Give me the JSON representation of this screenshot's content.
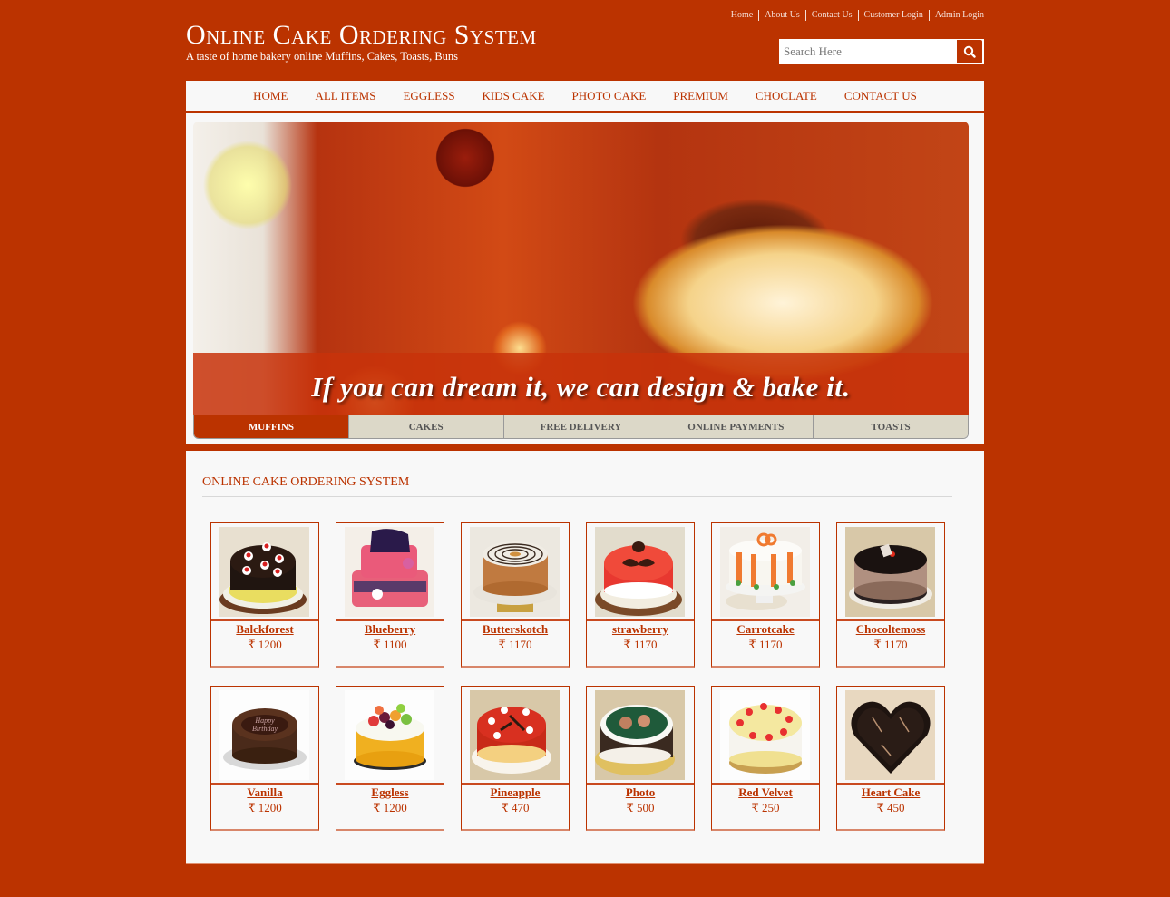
{
  "top_links": [
    "Home",
    "About Us",
    "Contact Us",
    "Customer Login",
    "Admin Login"
  ],
  "logo": {
    "title": "Online Cake Ordering System",
    "tagline": "A taste of home bakery online Muffins, Cakes, Toasts, Buns"
  },
  "search": {
    "placeholder": "Search Here",
    "value": "",
    "icon": "search-icon"
  },
  "nav": [
    "HOME",
    "ALL ITEMS",
    "EGGLESS",
    "KIDS CAKE",
    "PHOTO CAKE",
    "PREMIUM",
    "CHOCLATE",
    "CONTACT US"
  ],
  "banner": {
    "caption": "If you can dream it, we can design & bake it."
  },
  "tabs": [
    {
      "label": "MUFFINS",
      "active": true
    },
    {
      "label": "CAKES",
      "active": false
    },
    {
      "label": "FREE DELIVERY",
      "active": false
    },
    {
      "label": "ONLINE PAYMENTS",
      "active": false
    },
    {
      "label": "TOASTS",
      "active": false
    }
  ],
  "section": {
    "title": "ONLINE CAKE ORDERING SYSTEM"
  },
  "currency_symbol": "₹",
  "products": [
    {
      "name": "Balckforest",
      "price": "₹ 1200",
      "image": "black-forest-cake"
    },
    {
      "name": "Blueberry",
      "price": "₹ 1100",
      "image": "pink-tiered-cake"
    },
    {
      "name": "Butterskotch",
      "price": "₹ 1170",
      "image": "butterscotch-cake"
    },
    {
      "name": "strawberry",
      "price": "₹ 1170",
      "image": "strawberry-cake"
    },
    {
      "name": "Carrotcake",
      "price": "₹ 1170",
      "image": "carrot-cake"
    },
    {
      "name": "Chocoltemoss",
      "price": "₹ 1170",
      "image": "chocolate-mousse-cake"
    },
    {
      "name": "Vanilla",
      "price": "₹ 1200",
      "image": "happy-birthday-chocolate-cake"
    },
    {
      "name": "Eggless",
      "price": "₹ 1200",
      "image": "fruit-cake"
    },
    {
      "name": "Pineapple",
      "price": "₹ 470",
      "image": "red-cake"
    },
    {
      "name": "Photo",
      "price": "₹ 500",
      "image": "photo-cake"
    },
    {
      "name": "Red Velvet",
      "price": "₹ 250",
      "image": "pineapple-cherry-cake"
    },
    {
      "name": "Heart Cake",
      "price": "₹ 450",
      "image": "heart-chocolate-cake"
    }
  ],
  "colors": {
    "brand": "#bb3300",
    "panel": "#f8f8f8",
    "tab_inactive": "#dcd8c8"
  }
}
